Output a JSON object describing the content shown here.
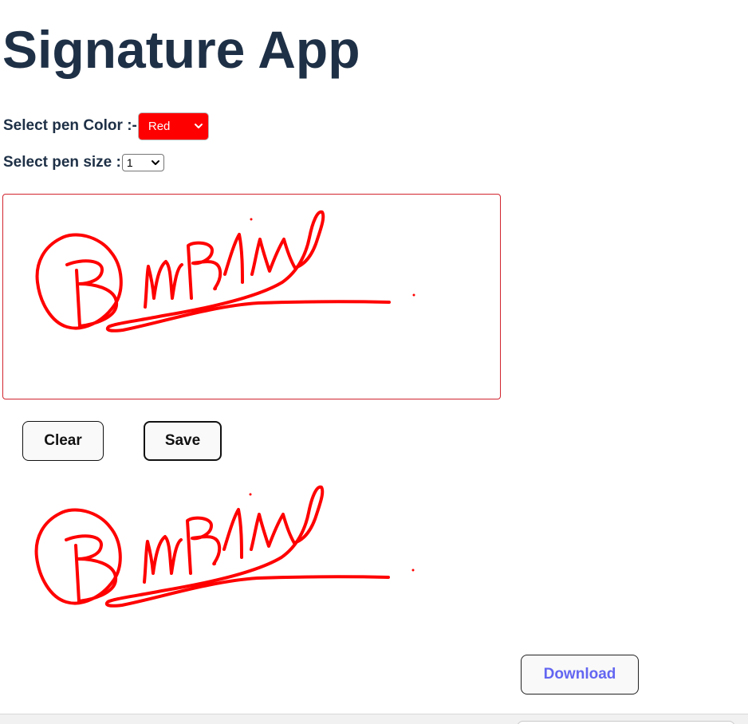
{
  "app": {
    "title": "Signature App"
  },
  "controls": {
    "pen_color_label": "Select pen Color :-",
    "pen_color_value": "Red",
    "pen_color_hex": "#ff0000",
    "pen_size_label": "Select pen size :",
    "pen_size_value": "1"
  },
  "buttons": {
    "clear_label": "Clear",
    "save_label": "Save",
    "download_label": "Download"
  },
  "colors": {
    "title": "#1e3046",
    "canvas_border": "#d1242f",
    "stroke": "#ff0000",
    "download_text": "#6366f1"
  },
  "icons": {
    "select_arrow": "chevron-down-icon"
  }
}
